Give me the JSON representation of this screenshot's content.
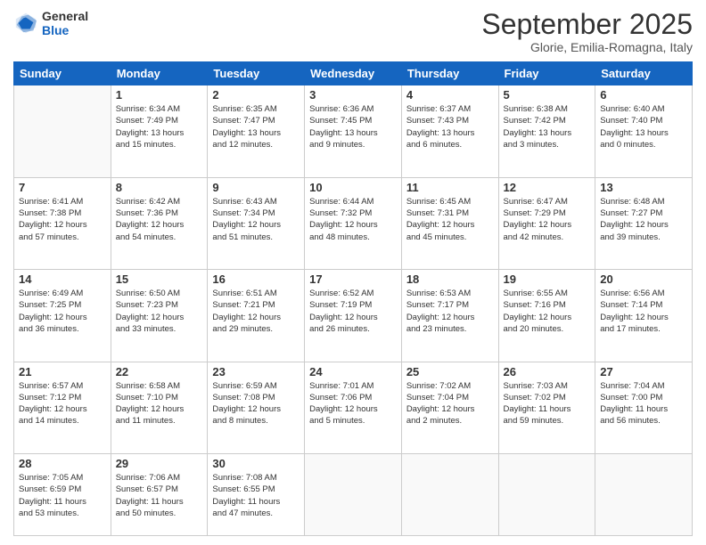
{
  "logo": {
    "general": "General",
    "blue": "Blue"
  },
  "header": {
    "month": "September 2025",
    "location": "Glorie, Emilia-Romagna, Italy"
  },
  "weekdays": [
    "Sunday",
    "Monday",
    "Tuesday",
    "Wednesday",
    "Thursday",
    "Friday",
    "Saturday"
  ],
  "weeks": [
    [
      {
        "day": "",
        "info": ""
      },
      {
        "day": "1",
        "info": "Sunrise: 6:34 AM\nSunset: 7:49 PM\nDaylight: 13 hours\nand 15 minutes."
      },
      {
        "day": "2",
        "info": "Sunrise: 6:35 AM\nSunset: 7:47 PM\nDaylight: 13 hours\nand 12 minutes."
      },
      {
        "day": "3",
        "info": "Sunrise: 6:36 AM\nSunset: 7:45 PM\nDaylight: 13 hours\nand 9 minutes."
      },
      {
        "day": "4",
        "info": "Sunrise: 6:37 AM\nSunset: 7:43 PM\nDaylight: 13 hours\nand 6 minutes."
      },
      {
        "day": "5",
        "info": "Sunrise: 6:38 AM\nSunset: 7:42 PM\nDaylight: 13 hours\nand 3 minutes."
      },
      {
        "day": "6",
        "info": "Sunrise: 6:40 AM\nSunset: 7:40 PM\nDaylight: 13 hours\nand 0 minutes."
      }
    ],
    [
      {
        "day": "7",
        "info": "Sunrise: 6:41 AM\nSunset: 7:38 PM\nDaylight: 12 hours\nand 57 minutes."
      },
      {
        "day": "8",
        "info": "Sunrise: 6:42 AM\nSunset: 7:36 PM\nDaylight: 12 hours\nand 54 minutes."
      },
      {
        "day": "9",
        "info": "Sunrise: 6:43 AM\nSunset: 7:34 PM\nDaylight: 12 hours\nand 51 minutes."
      },
      {
        "day": "10",
        "info": "Sunrise: 6:44 AM\nSunset: 7:32 PM\nDaylight: 12 hours\nand 48 minutes."
      },
      {
        "day": "11",
        "info": "Sunrise: 6:45 AM\nSunset: 7:31 PM\nDaylight: 12 hours\nand 45 minutes."
      },
      {
        "day": "12",
        "info": "Sunrise: 6:47 AM\nSunset: 7:29 PM\nDaylight: 12 hours\nand 42 minutes."
      },
      {
        "day": "13",
        "info": "Sunrise: 6:48 AM\nSunset: 7:27 PM\nDaylight: 12 hours\nand 39 minutes."
      }
    ],
    [
      {
        "day": "14",
        "info": "Sunrise: 6:49 AM\nSunset: 7:25 PM\nDaylight: 12 hours\nand 36 minutes."
      },
      {
        "day": "15",
        "info": "Sunrise: 6:50 AM\nSunset: 7:23 PM\nDaylight: 12 hours\nand 33 minutes."
      },
      {
        "day": "16",
        "info": "Sunrise: 6:51 AM\nSunset: 7:21 PM\nDaylight: 12 hours\nand 29 minutes."
      },
      {
        "day": "17",
        "info": "Sunrise: 6:52 AM\nSunset: 7:19 PM\nDaylight: 12 hours\nand 26 minutes."
      },
      {
        "day": "18",
        "info": "Sunrise: 6:53 AM\nSunset: 7:17 PM\nDaylight: 12 hours\nand 23 minutes."
      },
      {
        "day": "19",
        "info": "Sunrise: 6:55 AM\nSunset: 7:16 PM\nDaylight: 12 hours\nand 20 minutes."
      },
      {
        "day": "20",
        "info": "Sunrise: 6:56 AM\nSunset: 7:14 PM\nDaylight: 12 hours\nand 17 minutes."
      }
    ],
    [
      {
        "day": "21",
        "info": "Sunrise: 6:57 AM\nSunset: 7:12 PM\nDaylight: 12 hours\nand 14 minutes."
      },
      {
        "day": "22",
        "info": "Sunrise: 6:58 AM\nSunset: 7:10 PM\nDaylight: 12 hours\nand 11 minutes."
      },
      {
        "day": "23",
        "info": "Sunrise: 6:59 AM\nSunset: 7:08 PM\nDaylight: 12 hours\nand 8 minutes."
      },
      {
        "day": "24",
        "info": "Sunrise: 7:01 AM\nSunset: 7:06 PM\nDaylight: 12 hours\nand 5 minutes."
      },
      {
        "day": "25",
        "info": "Sunrise: 7:02 AM\nSunset: 7:04 PM\nDaylight: 12 hours\nand 2 minutes."
      },
      {
        "day": "26",
        "info": "Sunrise: 7:03 AM\nSunset: 7:02 PM\nDaylight: 11 hours\nand 59 minutes."
      },
      {
        "day": "27",
        "info": "Sunrise: 7:04 AM\nSunset: 7:00 PM\nDaylight: 11 hours\nand 56 minutes."
      }
    ],
    [
      {
        "day": "28",
        "info": "Sunrise: 7:05 AM\nSunset: 6:59 PM\nDaylight: 11 hours\nand 53 minutes."
      },
      {
        "day": "29",
        "info": "Sunrise: 7:06 AM\nSunset: 6:57 PM\nDaylight: 11 hours\nand 50 minutes."
      },
      {
        "day": "30",
        "info": "Sunrise: 7:08 AM\nSunset: 6:55 PM\nDaylight: 11 hours\nand 47 minutes."
      },
      {
        "day": "",
        "info": ""
      },
      {
        "day": "",
        "info": ""
      },
      {
        "day": "",
        "info": ""
      },
      {
        "day": "",
        "info": ""
      }
    ]
  ]
}
